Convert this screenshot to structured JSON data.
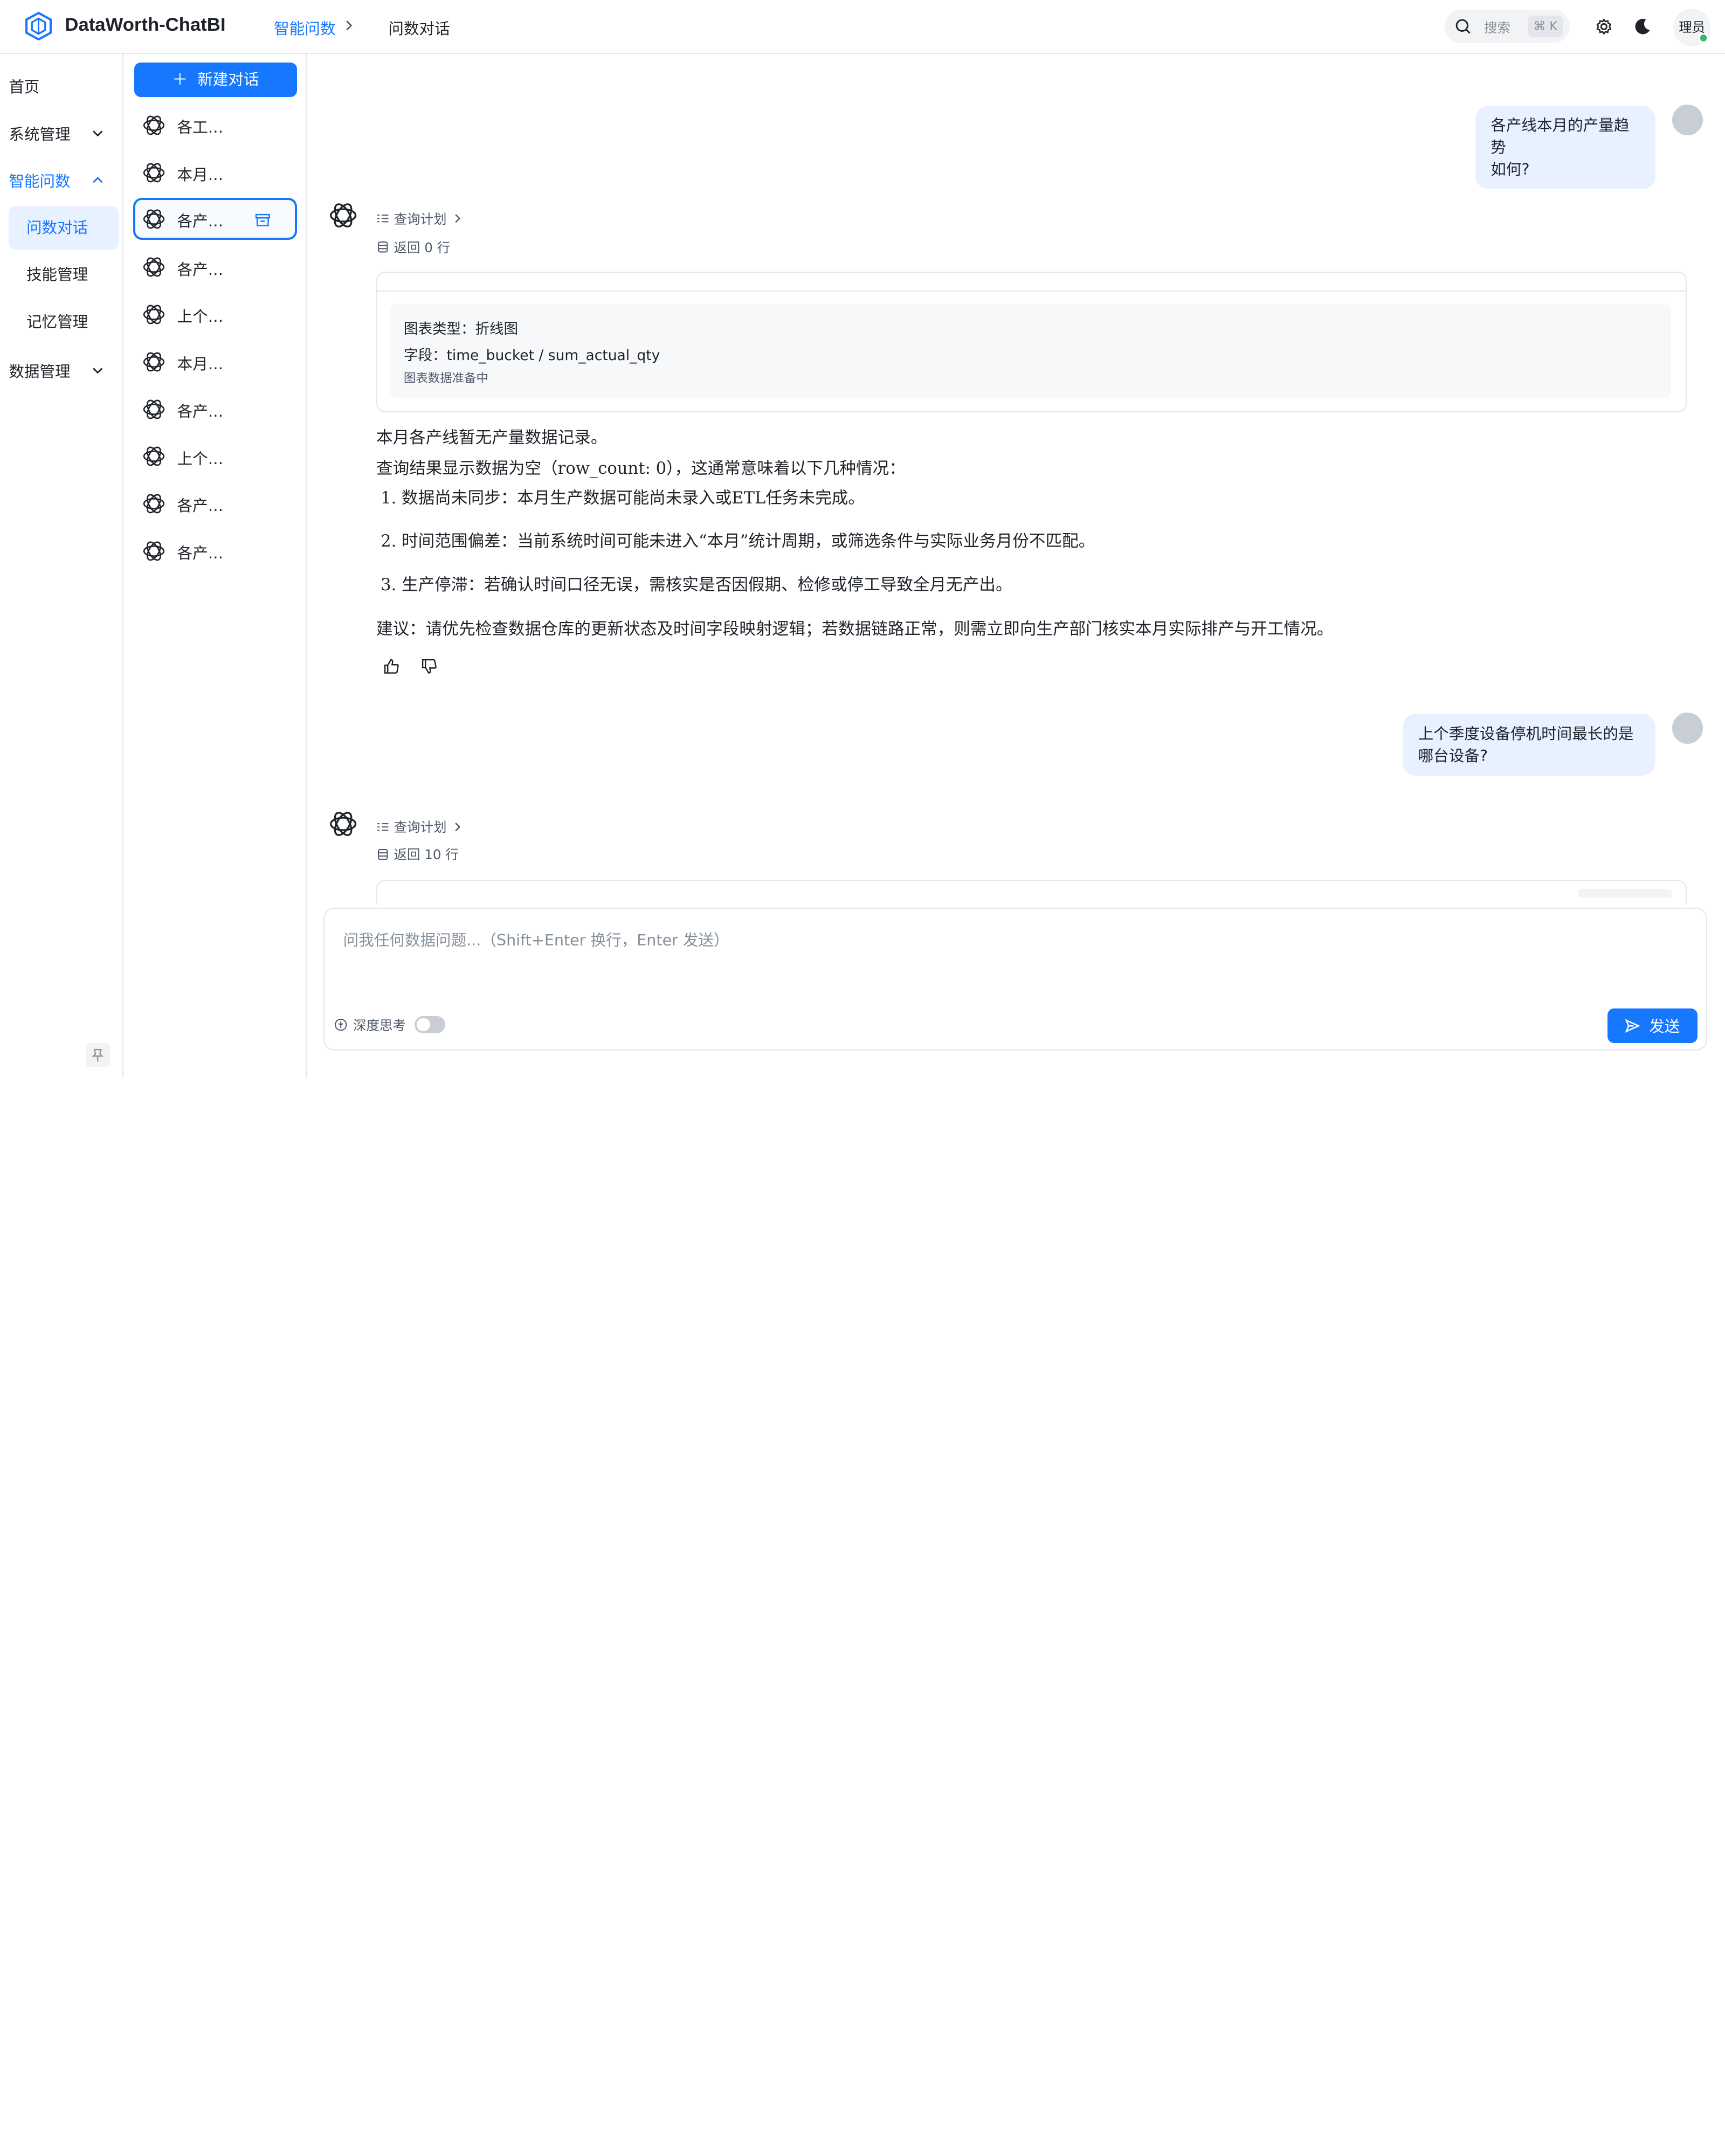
{
  "header": {
    "brand": "DataWorth-ChatBI",
    "breadcrumb": [
      "智能问数",
      "问数对话"
    ],
    "search_label": "搜索",
    "search_shortcut": "⌘ K",
    "avatar_text": "理员"
  },
  "nav": {
    "items": [
      {
        "label": "首页"
      },
      {
        "label": "系统管理"
      },
      {
        "label": "智能问数"
      },
      {
        "label": "数据管理"
      }
    ],
    "sub_items": [
      {
        "label": "问数对话"
      },
      {
        "label": "技能管理"
      },
      {
        "label": "记忆管理"
      }
    ]
  },
  "conversations": {
    "new_button": "新建对话",
    "items": [
      "各工…",
      "本月…",
      "各产…",
      "各产…",
      "上个…",
      "本月…",
      "各产…",
      "上个…",
      "各产…",
      "各产…"
    ]
  },
  "chat": {
    "user_msg_1": [
      "各产线本月的产量趋势",
      "如何?"
    ],
    "query_plan_label": "查询计划",
    "rows_1": "返回 0 行",
    "chart_card": {
      "type_line": "图表类型：折线图",
      "fields_line": "字段：time_bucket / sum_actual_qty",
      "status_line": "图表数据准备中"
    },
    "answer": {
      "line1": "本月各产线暂无产量数据记录。",
      "line2": "查询结果显示数据为空（row_count: 0），这通常意味着以下几种情况：",
      "list": [
        "1. 数据尚未同步：本月生产数据可能尚未录入或ETL任务未完成。",
        "2. 时间范围偏差：当前系统时间可能未进入“本月”统计周期，或筛选条件与实际业务月份不匹配。",
        "3. 生产停滞：若确认时间口径无误，需核实是否因假期、检修或停工导致全月无产出。"
      ],
      "suggestion": "建议：请优先检查数据仓库的更新状态及时间字段映射逻辑；若数据链路正常，则需立即向生产部门核实本月实际排产与开工情况。"
    },
    "user_msg_2": [
      "上个季度设备停机时间最长的是",
      "哪台设备?"
    ],
    "rows_2": "返回 10 行"
  },
  "input": {
    "placeholder": "问我任何数据问题...（Shift+Enter 换行，Enter 发送）",
    "deep_think_label": "深度思考",
    "send_label": "发送"
  },
  "colors": {
    "accent": "#1677ff",
    "user_bubble": "#e8f1ff",
    "status_online": "#3ab36b"
  }
}
